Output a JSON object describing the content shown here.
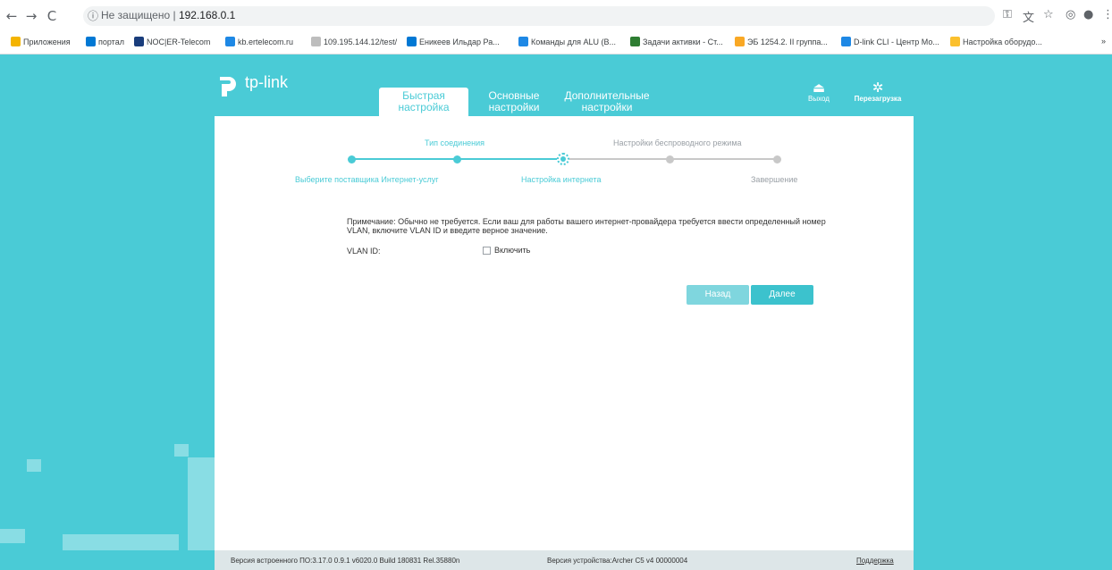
{
  "browser": {
    "security_text": "Не защищено",
    "separator": "|",
    "url": "192.168.0.1"
  },
  "bookmarks": [
    {
      "label": "Приложения",
      "color": "#f4b400"
    },
    {
      "label": "портал",
      "color": "#0078d4"
    },
    {
      "label": "NOC|ER-Telecom",
      "color": "#1a3d7c"
    },
    {
      "label": "kb.ertelecom.ru",
      "color": "#1e88e5"
    },
    {
      "label": "109.195.144.12/test/",
      "color": "#bdbdbd"
    },
    {
      "label": "Еникеев Ильдар Ра...",
      "color": "#0078d4"
    },
    {
      "label": "Команды для ALU (В...",
      "color": "#1e88e5"
    },
    {
      "label": "Задачи активки - Ст...",
      "color": "#2e7d32"
    },
    {
      "label": "ЭБ 1254.2. II группа...",
      "color": "#f9a825"
    },
    {
      "label": "D-link CLI - Центр Мо...",
      "color": "#1e88e5"
    },
    {
      "label": "Настройка оборудо...",
      "color": "#fbc02d"
    }
  ],
  "bookmarks_more": "»",
  "brand": {
    "name": "tp-link",
    "accent": "#4acbd6"
  },
  "tabs": {
    "quick": "Быстрая настройка",
    "basic": "Основные настройки",
    "advanced": "Дополнительные настройки"
  },
  "header": {
    "logout": "Выход",
    "reboot": "Перезагрузка"
  },
  "wizard": {
    "step1": "Выберите поставщика Интернет-услуг",
    "step2": "Тип соединения",
    "step3": "Настройка интернета",
    "step4": "Настройки беспроводного режима",
    "step5": "Завершение",
    "current_step": 3
  },
  "form": {
    "note": "Примечание: Обычно не требуется. Если ваш для работы вашего интернет-провайдера требуется ввести определенный номер VLAN, включите VLAN ID и введите верное значение.",
    "vlan_label": "VLAN ID:",
    "vlan_enable": "Включить",
    "vlan_checked": false
  },
  "buttons": {
    "back": "Назад",
    "next": "Далее"
  },
  "footer": {
    "firmware": "Версия встроенного ПО:3.17.0 0.9.1 v6020.0 Build 180831 Rel.35880n",
    "hardware": "Версия устройства:Archer C5 v4 00000004",
    "support": "Поддержка"
  }
}
